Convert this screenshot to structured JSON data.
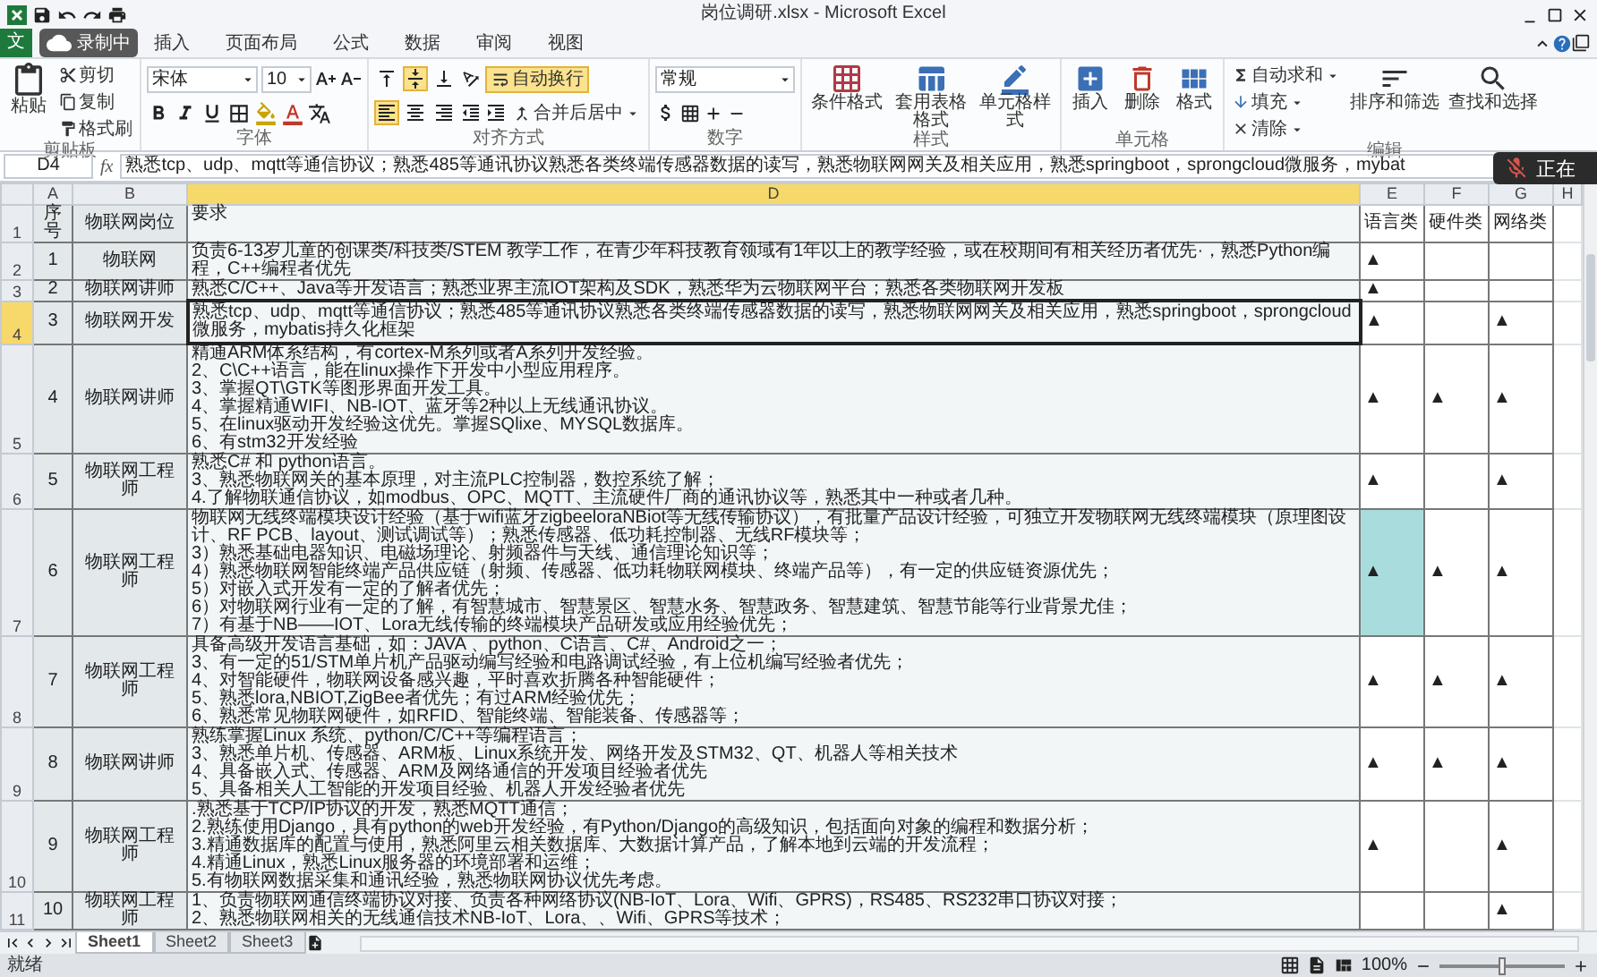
{
  "window": {
    "title": "岗位调研.xlsx - Microsoft Excel"
  },
  "recording": {
    "label": "录制中"
  },
  "mic_overlay": {
    "label": "正在"
  },
  "file_tab": {
    "label": "文"
  },
  "tabs": [
    {
      "label": "插入",
      "selected": false
    },
    {
      "label": "页面布局",
      "selected": false
    },
    {
      "label": "公式",
      "selected": false
    },
    {
      "label": "数据",
      "selected": false
    },
    {
      "label": "审阅",
      "selected": false
    },
    {
      "label": "视图",
      "selected": false
    }
  ],
  "clipboard": {
    "label": "剪贴板",
    "paste": "粘贴",
    "cut": "剪切",
    "copy": "复制",
    "format_painter": "格式刷"
  },
  "font": {
    "label": "字体",
    "name": "宋体",
    "size": "10"
  },
  "alignment": {
    "label": "对齐方式",
    "wrap_text": {
      "label": "自动换行",
      "on": true
    },
    "merge": "合并后居中",
    "vertical": [
      {
        "selected": false
      },
      {
        "selected": true
      },
      {
        "selected": false
      }
    ],
    "horizontal": [
      {
        "selected": true
      },
      {
        "selected": false
      },
      {
        "selected": false
      }
    ]
  },
  "number": {
    "label": "数字",
    "format": "常规"
  },
  "styles": {
    "label": "样式",
    "conditional": "条件格式",
    "table": "套用表格格式",
    "cell_styles": "单元格样式"
  },
  "cells": {
    "label": "单元格",
    "insert": "插入",
    "delete": "删除",
    "format": "格式"
  },
  "editing": {
    "label": "编辑",
    "autosum": "自动求和",
    "fill": "填充",
    "clear": "清除",
    "sort": "排序和筛选",
    "find": "查找和选择"
  },
  "formula_bar": {
    "name_box": "D4",
    "fx": "fx",
    "value": "熟悉tcp、udp、mqtt等通信协议；熟悉485等通讯协议熟悉各类终端传感器数据的读写，熟悉物联网网关及相关应用，熟悉springboot，sprongcloud微服务，mybat"
  },
  "columns": [
    {
      "label": "A",
      "selected": false
    },
    {
      "label": "B",
      "selected": false
    },
    {
      "label": "D",
      "selected": true
    },
    {
      "label": "E",
      "selected": false
    },
    {
      "label": "F",
      "selected": false
    },
    {
      "label": "G",
      "selected": false
    },
    {
      "label": "H",
      "selected": false
    }
  ],
  "rows": [
    {
      "number": "1",
      "selected": false,
      "a": "序号",
      "b": "物联网岗位",
      "d": [
        "要求"
      ],
      "categories": [
        {
          "text": "语言类",
          "highlighted": false
        },
        {
          "text": "硬件类",
          "highlighted": false
        },
        {
          "text": "网络类",
          "highlighted": false
        }
      ]
    },
    {
      "number": "2",
      "selected": false,
      "a": "1",
      "b": "物联网",
      "d": [
        "负责6-13岁儿童的创课类/科技类/STEM 教学工作，在青少年科技教育领域有1年以上的教学经验，或在校期间有相关经历者优先·，熟悉Python编程，C++编程者优先"
      ],
      "categories": [
        {
          "text": "▲",
          "highlighted": false
        },
        {
          "highlighted": false
        },
        {
          "highlighted": false
        }
      ]
    },
    {
      "number": "3",
      "selected": false,
      "a": "2",
      "b": "物联网讲师",
      "d": [
        "熟悉C/C++、Java等开发语言；熟悉业界主流IOT架构及SDK，熟悉华为云物联网平台；熟悉各类物联网开发板"
      ],
      "categories": [
        {
          "text": "▲",
          "highlighted": false
        },
        {
          "highlighted": false
        },
        {
          "highlighted": false
        }
      ]
    },
    {
      "number": "4",
      "selected": true,
      "a": "3",
      "b": "物联网开发",
      "d": [
        "熟悉tcp、udp、mqtt等通信协议；熟悉485等通讯协议熟悉各类终端传感器数据的读写，熟悉物联网网关及相关应用，熟悉springboot，sprongcloud微服务，mybatis持久化框架"
      ],
      "categories": [
        {
          "text": "▲",
          "highlighted": false
        },
        {
          "highlighted": false
        },
        {
          "text": "▲",
          "highlighted": false
        }
      ]
    },
    {
      "number": "5",
      "selected": false,
      "a": "4",
      "b": "物联网讲师",
      "d": [
        "精通ARM体系结构，有cortex-M系列或者A系列开发经验。",
        "2、C\\C++语言，能在linux操作下开发中小型应用程序。",
        "3、掌握QT\\GTK等图形界面开发工具。",
        "4、掌握精通WIFI、NB-IOT、蓝牙等2种以上无线通讯协议。",
        "5、在linux驱动开发经验这优先。掌握SQlixe、MYSQL数据库。",
        "6、有stm32开发经验"
      ],
      "categories": [
        {
          "text": "▲",
          "highlighted": false
        },
        {
          "text": "▲",
          "highlighted": false
        },
        {
          "text": "▲",
          "highlighted": false
        }
      ]
    },
    {
      "number": "6",
      "selected": false,
      "a": "5",
      "b": "物联网工程师",
      "d": [
        "熟悉C# 和 python语言。",
        "3、熟悉物联网关的基本原理，对主流PLC控制器，数控系统了解；",
        "4.了解物联通信协议，如modbus、OPC、MQTT、主流硬件厂商的通讯协议等，熟悉其中一种或者几种。"
      ],
      "categories": [
        {
          "text": "▲",
          "highlighted": false
        },
        {
          "highlighted": false
        },
        {
          "text": "▲",
          "highlighted": false
        }
      ]
    },
    {
      "number": "7",
      "selected": false,
      "a": "6",
      "b": "物联网工程师",
      "d": [
        "物联网无线终端模块设计经验（基于wifi蓝牙zigbeeloraNBiot等无线传输协议），有批量产品设计经验，可独立开发物联网无线终端模块（原理图设计、RF PCB、layout、测试调试等）；熟悉传感器、低功耗控制器、无线RF模块等；",
        "3）熟悉基础电器知识、电磁场理论、射频器件与天线、通信理论知识等；",
        "4）熟悉物联网智能终端产品供应链（射频、传感器、低功耗物联网模块、终端产品等），有一定的供应链资源优先；",
        "5）对嵌入式开发有一定的了解者优先；",
        "6）对物联网行业有一定的了解，有智慧城市、智慧景区、智慧水务、智慧政务、智慧建筑、智慧节能等行业背景尤佳；",
        "7）有基于NB——IOT、Lora无线传输的终端模块产品研发或应用经验优先；"
      ],
      "categories": [
        {
          "text": "▲",
          "highlighted": true
        },
        {
          "text": "▲",
          "highlighted": false
        },
        {
          "text": "▲",
          "highlighted": false
        }
      ]
    },
    {
      "number": "8",
      "selected": false,
      "a": "7",
      "b": "物联网工程师",
      "d": [
        "具备高级开发语言基础，如：JAVA 、python、C语言、C#、Android之一；",
        "3、有一定的51/STM单片机产品驱动编写经验和电路调试经验，有上位机编写经验者优先；",
        "4、对智能硬件，物联网设备感兴趣，平时喜欢折腾各种智能硬件；",
        "5、熟悉lora,NBIOT,ZigBee者优先；有过ARM经验优先；",
        "6、熟悉常见物联网硬件，如RFID、智能终端、智能装备、传感器等；"
      ],
      "categories": [
        {
          "text": "▲",
          "highlighted": false
        },
        {
          "text": "▲",
          "highlighted": false
        },
        {
          "text": "▲",
          "highlighted": false
        }
      ]
    },
    {
      "number": "9",
      "selected": false,
      "a": "8",
      "b": "物联网讲师",
      "d": [
        "熟练掌握Linux 系统、python/C/C++等编程语言；",
        "3、熟悉单片机、传感器、ARM板、Linux系统开发、网络开发及STM32、QT、机器人等相关技术",
        "4、具备嵌入式、传感器、ARM及网络通信的开发项目经验者优先",
        "5、具备相关人工智能的开发项目经验、机器人开发经验者优先"
      ],
      "categories": [
        {
          "text": "▲",
          "highlighted": false
        },
        {
          "text": "▲",
          "highlighted": false
        },
        {
          "text": "▲",
          "highlighted": false
        }
      ]
    },
    {
      "number": "10",
      "selected": false,
      "a": "9",
      "b": "物联网工程师",
      "d": [
        ".熟悉基于TCP/IP协议的开发，熟悉MQTT通信；",
        "2.熟练使用Django，具有python的web开发经验，有Python/Django的高级知识，包括面向对象的编程和数据分析；",
        "3.精通数据库的配置与使用，熟悉阿里云相关数据库、大数据计算产品，了解本地到云端的开发流程；",
        "4.精通Linux，熟悉Linux服务器的环境部署和运维；",
        "5.有物联网数据采集和通讯经验，熟悉物联网协议优先考虑。"
      ],
      "categories": [
        {
          "text": "▲",
          "highlighted": false
        },
        {
          "highlighted": false
        },
        {
          "text": "▲",
          "highlighted": false
        }
      ]
    },
    {
      "number": "11",
      "selected": false,
      "a": "10",
      "b": "物联网工程师",
      "d": [
        "1、负责物联网通信终端协议对接、负责各种网络协议(NB-IoT、Lora、Wifi、GPRS)，RS485、RS232串口协议对接；",
        "2、熟悉物联网相关的无线通信技术NB-IoT、Lora、、Wifi、GPRS等技术；"
      ],
      "categories": [
        {
          "highlighted": false
        },
        {
          "highlighted": false
        },
        {
          "text": "▲",
          "highlighted": false
        }
      ]
    }
  ],
  "sheets": [
    {
      "label": "Sheet1",
      "selected": true
    },
    {
      "label": "Sheet2",
      "selected": false
    },
    {
      "label": "Sheet3",
      "selected": false
    }
  ],
  "status_bar": {
    "status": "就绪",
    "zoom": {
      "label": "100%",
      "level": 0.5
    }
  }
}
